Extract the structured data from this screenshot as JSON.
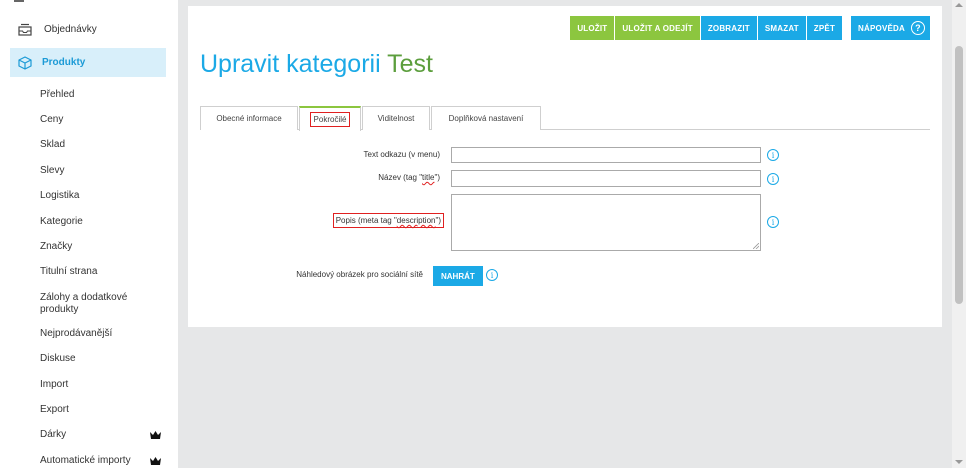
{
  "sidebar": {
    "orders": "Objednávky",
    "products": "Produkty",
    "items": [
      "Přehled",
      "Ceny",
      "Sklad",
      "Slevy",
      "Logistika",
      "Kategorie",
      "Značky",
      "Titulní strana",
      "Zálohy a dodatkové produkty",
      "Nejprodávanější",
      "Diskuse",
      "Import",
      "Export",
      "Dárky",
      "Automatické importy"
    ]
  },
  "toolbar": {
    "save": "ULOŽIT",
    "save_leave": "ULOŽIT A ODEJÍT",
    "show": "ZOBRAZIT",
    "delete": "SMAZAT",
    "back": "ZPĚT",
    "help": "NÁPOVĚDA",
    "help_icon": "?"
  },
  "page": {
    "title": "Upravit kategorii",
    "category_name": "Test"
  },
  "tabs": [
    "Obecné informace",
    "Pokročilé",
    "Viditelnost",
    "Doplňková nastavení"
  ],
  "form": {
    "menu_text_label": "Text odkazu (v menu)",
    "menu_text_value": "",
    "title_label_prefix": "Název (tag \"",
    "title_label_word": "title",
    "title_label_suffix": "\")",
    "title_value": "",
    "desc_label_prefix": "Popis (meta tag \"",
    "desc_label_word": "description",
    "desc_label_suffix": "\")",
    "desc_value": "",
    "social_label": "Náhledový obrázek pro sociální sítě",
    "upload": "NAHRÁT",
    "info_glyph": "i"
  },
  "colors": {
    "accent_blue": "#1ba9e6",
    "accent_green": "#8cc63f",
    "highlight_red": "#e02020"
  }
}
